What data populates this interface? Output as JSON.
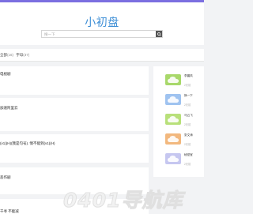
{
  "header": {
    "logo_text": "小初盘",
    "search_placeholder": "搜一下"
  },
  "filter": {
    "all_label": "全部",
    "all_count": "(16)",
    "words_label": "字母",
    "words_count": "(37)"
  },
  "results": [
    {
      "title": "电视剧"
    },
    {
      "title": "加速阿里云"
    },
    {
      "title": "(v1)(H)(我是句号). 情不能到(v1)(H)"
    },
    {
      "title": "恶作剧"
    },
    {
      "title": "千寻 不能减"
    }
  ],
  "sidebar": {
    "items": [
      {
        "name": "李晨风",
        "meta": "2天前",
        "color": "#a8d86a"
      },
      {
        "name": "换一下",
        "meta": "2天前",
        "color": "#9fc3f0"
      },
      {
        "name": "马云飞",
        "meta": "2天前",
        "color": "#b8e07a"
      },
      {
        "name": "张文涛",
        "meta": "2天前",
        "color": "#f2b87e"
      },
      {
        "name": "秘密宝",
        "meta": "2天前",
        "color": "#c6c7f0"
      }
    ]
  },
  "watermark": {
    "text": "0401导航库"
  },
  "colors": {
    "accent": "#3f8fd6",
    "top_bar": "#7b6fe0"
  }
}
